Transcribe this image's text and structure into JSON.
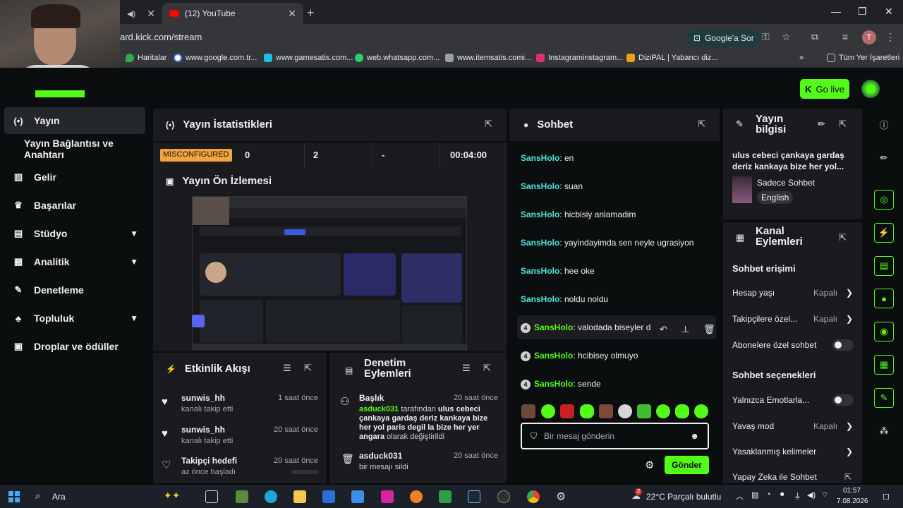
{
  "browser": {
    "tabs": [
      {
        "label": ""
      },
      {
        "label": "(12) YouTube"
      }
    ],
    "url": "ard.kick.com/stream",
    "ask_google": "Google'a Sor",
    "profile_initial": "T",
    "bookmarks": [
      {
        "label": "Haritalar",
        "color": "#34a853"
      },
      {
        "label": "www.google.com.tr...",
        "color": "#4285f4"
      },
      {
        "label": "www.gamesatis.com...",
        "color": "#1ec0e0"
      },
      {
        "label": "web.whatsapp.com...",
        "color": "#25d366"
      },
      {
        "label": "www.itemsatis.comi...",
        "color": "#9aa0a6"
      },
      {
        "label": "Instagraminstagram...",
        "color": "#e1306c"
      },
      {
        "label": "DiziPAL | Yabancı diz...",
        "color": "#e8a317"
      }
    ],
    "all_bookmarks": "Tüm Yer İşaretleri"
  },
  "header": {
    "go_live": "Go live"
  },
  "sidebar": {
    "items": [
      {
        "label": "Yayın",
        "icon": "broadcast-icon"
      },
      {
        "label": "Yayın Bağlantısı ve Anahtarı",
        "icon": ""
      },
      {
        "label": "Gelir",
        "icon": "chart-icon"
      },
      {
        "label": "Başarılar",
        "icon": "trophy-icon"
      },
      {
        "label": "Stüdyo",
        "icon": "studio-icon"
      },
      {
        "label": "Analitik",
        "icon": "analytics-icon"
      },
      {
        "label": "Denetleme",
        "icon": "wrench-icon"
      },
      {
        "label": "Topluluk",
        "icon": "community-icon"
      },
      {
        "label": "Droplar ve ödüller",
        "icon": "gift-icon"
      }
    ]
  },
  "stats": {
    "title": "Yayın İstatistikleri",
    "status": "MİSCONFIGURED",
    "viewers": "0",
    "followers": "2",
    "subs": "-",
    "duration": "00:04:00"
  },
  "preview": {
    "title": "Yayın Ön İzlemesi"
  },
  "activity": {
    "title": "Etkinlik Akışı",
    "items": [
      {
        "name": "sunwis_hh",
        "sub": "kanalı takip etti",
        "time": "1 saat önce"
      },
      {
        "name": "sunwis_hh",
        "sub": "kanalı takip etti",
        "time": "20 saat önce"
      },
      {
        "name": "Takipçi hedefi",
        "sub": "az önce başladı",
        "time": "20 saat önce"
      }
    ]
  },
  "moderation": {
    "title_line1": "Denetim",
    "title_line2": "Eylemleri",
    "items": [
      {
        "title": "Başlık",
        "time": "20 saat önce",
        "user": "asduck031",
        "by": " tarafından ",
        "value": "ulus cebeci çankaya gardaş deriz kankaya bize her yol paris degil la bize her yer angara",
        "suffix": " olarak değiştirildi"
      },
      {
        "title": "asduck031",
        "time": "20 saat önce",
        "sub": "bir mesajı sildi"
      }
    ]
  },
  "chat": {
    "title": "Sohbet",
    "messages": [
      {
        "user": "SansHolo",
        "text": ": en",
        "badge": ""
      },
      {
        "user": "SansHolo",
        "text": ": suan",
        "badge": ""
      },
      {
        "user": "SansHolo",
        "text": ": hicbisiy anlamadim",
        "badge": ""
      },
      {
        "user": "SansHolo",
        "text": ": yayindayimda sen neyle ugrasiyon",
        "badge": ""
      },
      {
        "user": "SansHolo",
        "text": ": hee oke",
        "badge": ""
      },
      {
        "user": "SansHolo",
        "text": ": noldu noldu",
        "badge": ""
      },
      {
        "user": "SansHolo",
        "text": ": valodada biseyler d",
        "badge": "4"
      },
      {
        "user": "SansHolo",
        "text": ": hcibisey olmuyo",
        "badge": "4"
      },
      {
        "user": "SansHolo",
        "text": ": sende",
        "badge": "4"
      }
    ],
    "placeholder": "Bir mesaj gönderin",
    "send": "Gönder"
  },
  "stream_info": {
    "title_line1": "Yayın",
    "title_line2": "bilgisi",
    "stream_title": "ulus cebeci çankaya gardaş deriz kankaya bize her yol...",
    "category": "Sadece Sohbet",
    "language": "English"
  },
  "channel_actions": {
    "title_line1": "Kanal",
    "title_line2": "Eylemleri",
    "chat_access": "Sohbet erişimi",
    "account_age": {
      "label": "Hesap yaşı",
      "state": "Kapalı"
    },
    "followers_only": {
      "label": "Takipçilere özel...",
      "state": "Kapalı"
    },
    "subs_only": {
      "label": "Abonelere özel sohbet"
    },
    "chat_options": "Sohbet seçenekleri",
    "emote_only": {
      "label": "Yalnızca Emotlarla..."
    },
    "slow_mode": {
      "label": "Yavaş mod",
      "state": "Kapalı"
    },
    "banned_words": {
      "label": "Yasaklanmış kelimeler"
    },
    "ai_chat": {
      "label": "Yapay Zeka ile Sohbet"
    }
  },
  "taskbar": {
    "search": "Ara",
    "weather": "22°C  Parçalı bulutlu",
    "weather_badge": "2",
    "time": "01:57",
    "date": "7.08.2026"
  },
  "colors": {
    "accent": "#53fc18",
    "username": "#4ee6d9",
    "warning": "#f2a53a"
  }
}
